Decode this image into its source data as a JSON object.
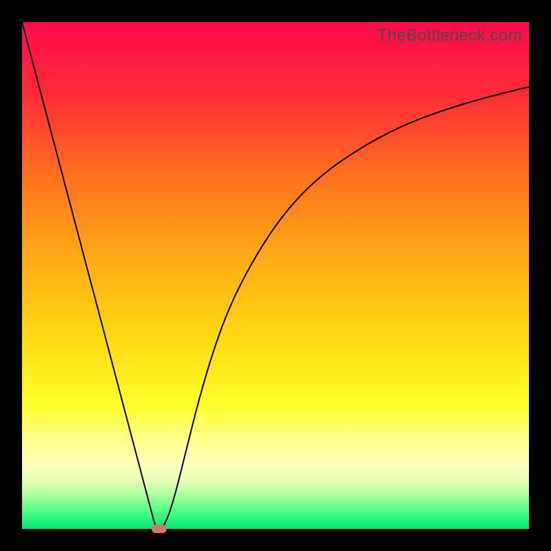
{
  "watermark": "TheBottleneck.com",
  "chart_data": {
    "type": "line",
    "title": "",
    "xlabel": "",
    "ylabel": "",
    "xlim": [
      0,
      1
    ],
    "ylim": [
      0,
      1
    ],
    "grid": false,
    "legend": false,
    "background_gradient_stops": [
      {
        "offset": 0.0,
        "color": "#ff0a4d"
      },
      {
        "offset": 0.14,
        "color": "#ff2b39"
      },
      {
        "offset": 0.3,
        "color": "#ff6f1f"
      },
      {
        "offset": 0.46,
        "color": "#ffa915"
      },
      {
        "offset": 0.62,
        "color": "#ffd814"
      },
      {
        "offset": 0.76,
        "color": "#ffff2e"
      },
      {
        "offset": 0.82,
        "color": "#ffff88"
      },
      {
        "offset": 0.87,
        "color": "#ffffb9"
      },
      {
        "offset": 0.905,
        "color": "#e6ffba"
      },
      {
        "offset": 0.935,
        "color": "#a7ff9d"
      },
      {
        "offset": 0.965,
        "color": "#4dff86"
      },
      {
        "offset": 1.0,
        "color": "#00e675"
      }
    ],
    "series": [
      {
        "name": "bottleneck-curve",
        "color": "#000000",
        "stroke_width": 2,
        "x": [
          0.0,
          0.02,
          0.04,
          0.06,
          0.08,
          0.1,
          0.12,
          0.14,
          0.16,
          0.18,
          0.2,
          0.22,
          0.24,
          0.26,
          0.265,
          0.275,
          0.285,
          0.3,
          0.32,
          0.35,
          0.38,
          0.41,
          0.45,
          0.5,
          0.55,
          0.6,
          0.65,
          0.7,
          0.75,
          0.8,
          0.85,
          0.9,
          0.95,
          1.0
        ],
        "y": [
          1.0,
          0.924,
          0.849,
          0.773,
          0.697,
          0.622,
          0.546,
          0.47,
          0.395,
          0.319,
          0.243,
          0.168,
          0.092,
          0.016,
          0.0,
          0.0,
          0.016,
          0.06,
          0.14,
          0.26,
          0.36,
          0.44,
          0.52,
          0.6,
          0.66,
          0.705,
          0.74,
          0.77,
          0.795,
          0.815,
          0.832,
          0.847,
          0.86,
          0.872
        ]
      }
    ],
    "marker": {
      "x": 0.27,
      "y": 0.0,
      "color": "#d4766e"
    }
  }
}
